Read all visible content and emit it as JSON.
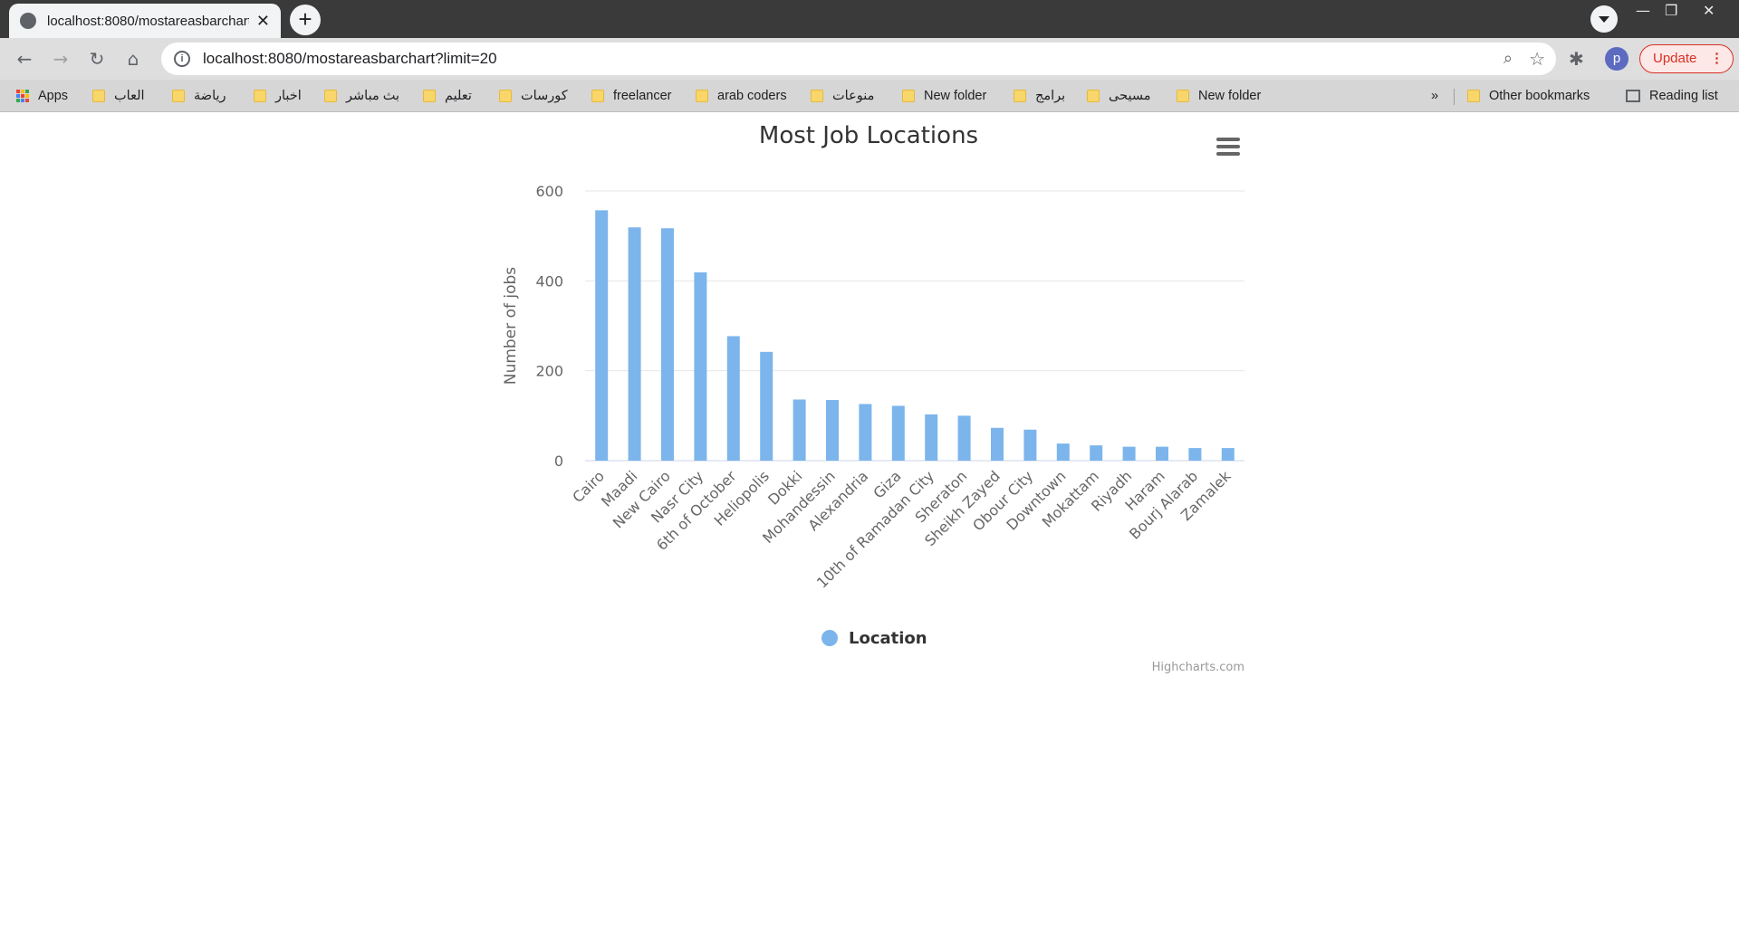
{
  "browser": {
    "tab_title": "localhost:8080/mostareasbarchart",
    "url": "localhost:8080/mostareasbarchart?limit=20",
    "profile_initial": "p",
    "update_label": "Update",
    "bookmarks": [
      "Apps",
      "العاب",
      "رياضة",
      "اخبار",
      "بث مباشر",
      "تعليم",
      "كورسات",
      "freelancer",
      "arab coders",
      "منوعات",
      "New folder",
      "برامج",
      "مسيحى",
      "New folder"
    ],
    "overflow": "»",
    "other_bookmarks": "Other bookmarks",
    "reading_list": "Reading list"
  },
  "chart_data": {
    "type": "bar",
    "title": "Most Job Locations",
    "xlabel": "",
    "ylabel": "Number of jobs",
    "ylim": [
      0,
      600
    ],
    "yticks": [
      0,
      200,
      400,
      600
    ],
    "categories": [
      "Cairo",
      "Maadi",
      "New Cairo",
      "Nasr City",
      "6th of October",
      "Heliopolis",
      "Dokki",
      "Mohandessin",
      "Alexandria",
      "Giza",
      "10th of Ramadan City",
      "Sheraton",
      "Sheikh Zayed",
      "Obour City",
      "Downtown",
      "Mokattam",
      "Riyadh",
      "Haram",
      "Bourj Alarab",
      "Zamalek"
    ],
    "series": [
      {
        "name": "Location",
        "color": "#7cb5ec",
        "values": [
          557,
          519,
          517,
          419,
          277,
          242,
          136,
          135,
          126,
          122,
          103,
          100,
          73,
          69,
          38,
          34,
          31,
          31,
          28,
          28
        ]
      }
    ],
    "grid": true,
    "legend": "bottom-center",
    "credits": "Highcharts.com"
  }
}
